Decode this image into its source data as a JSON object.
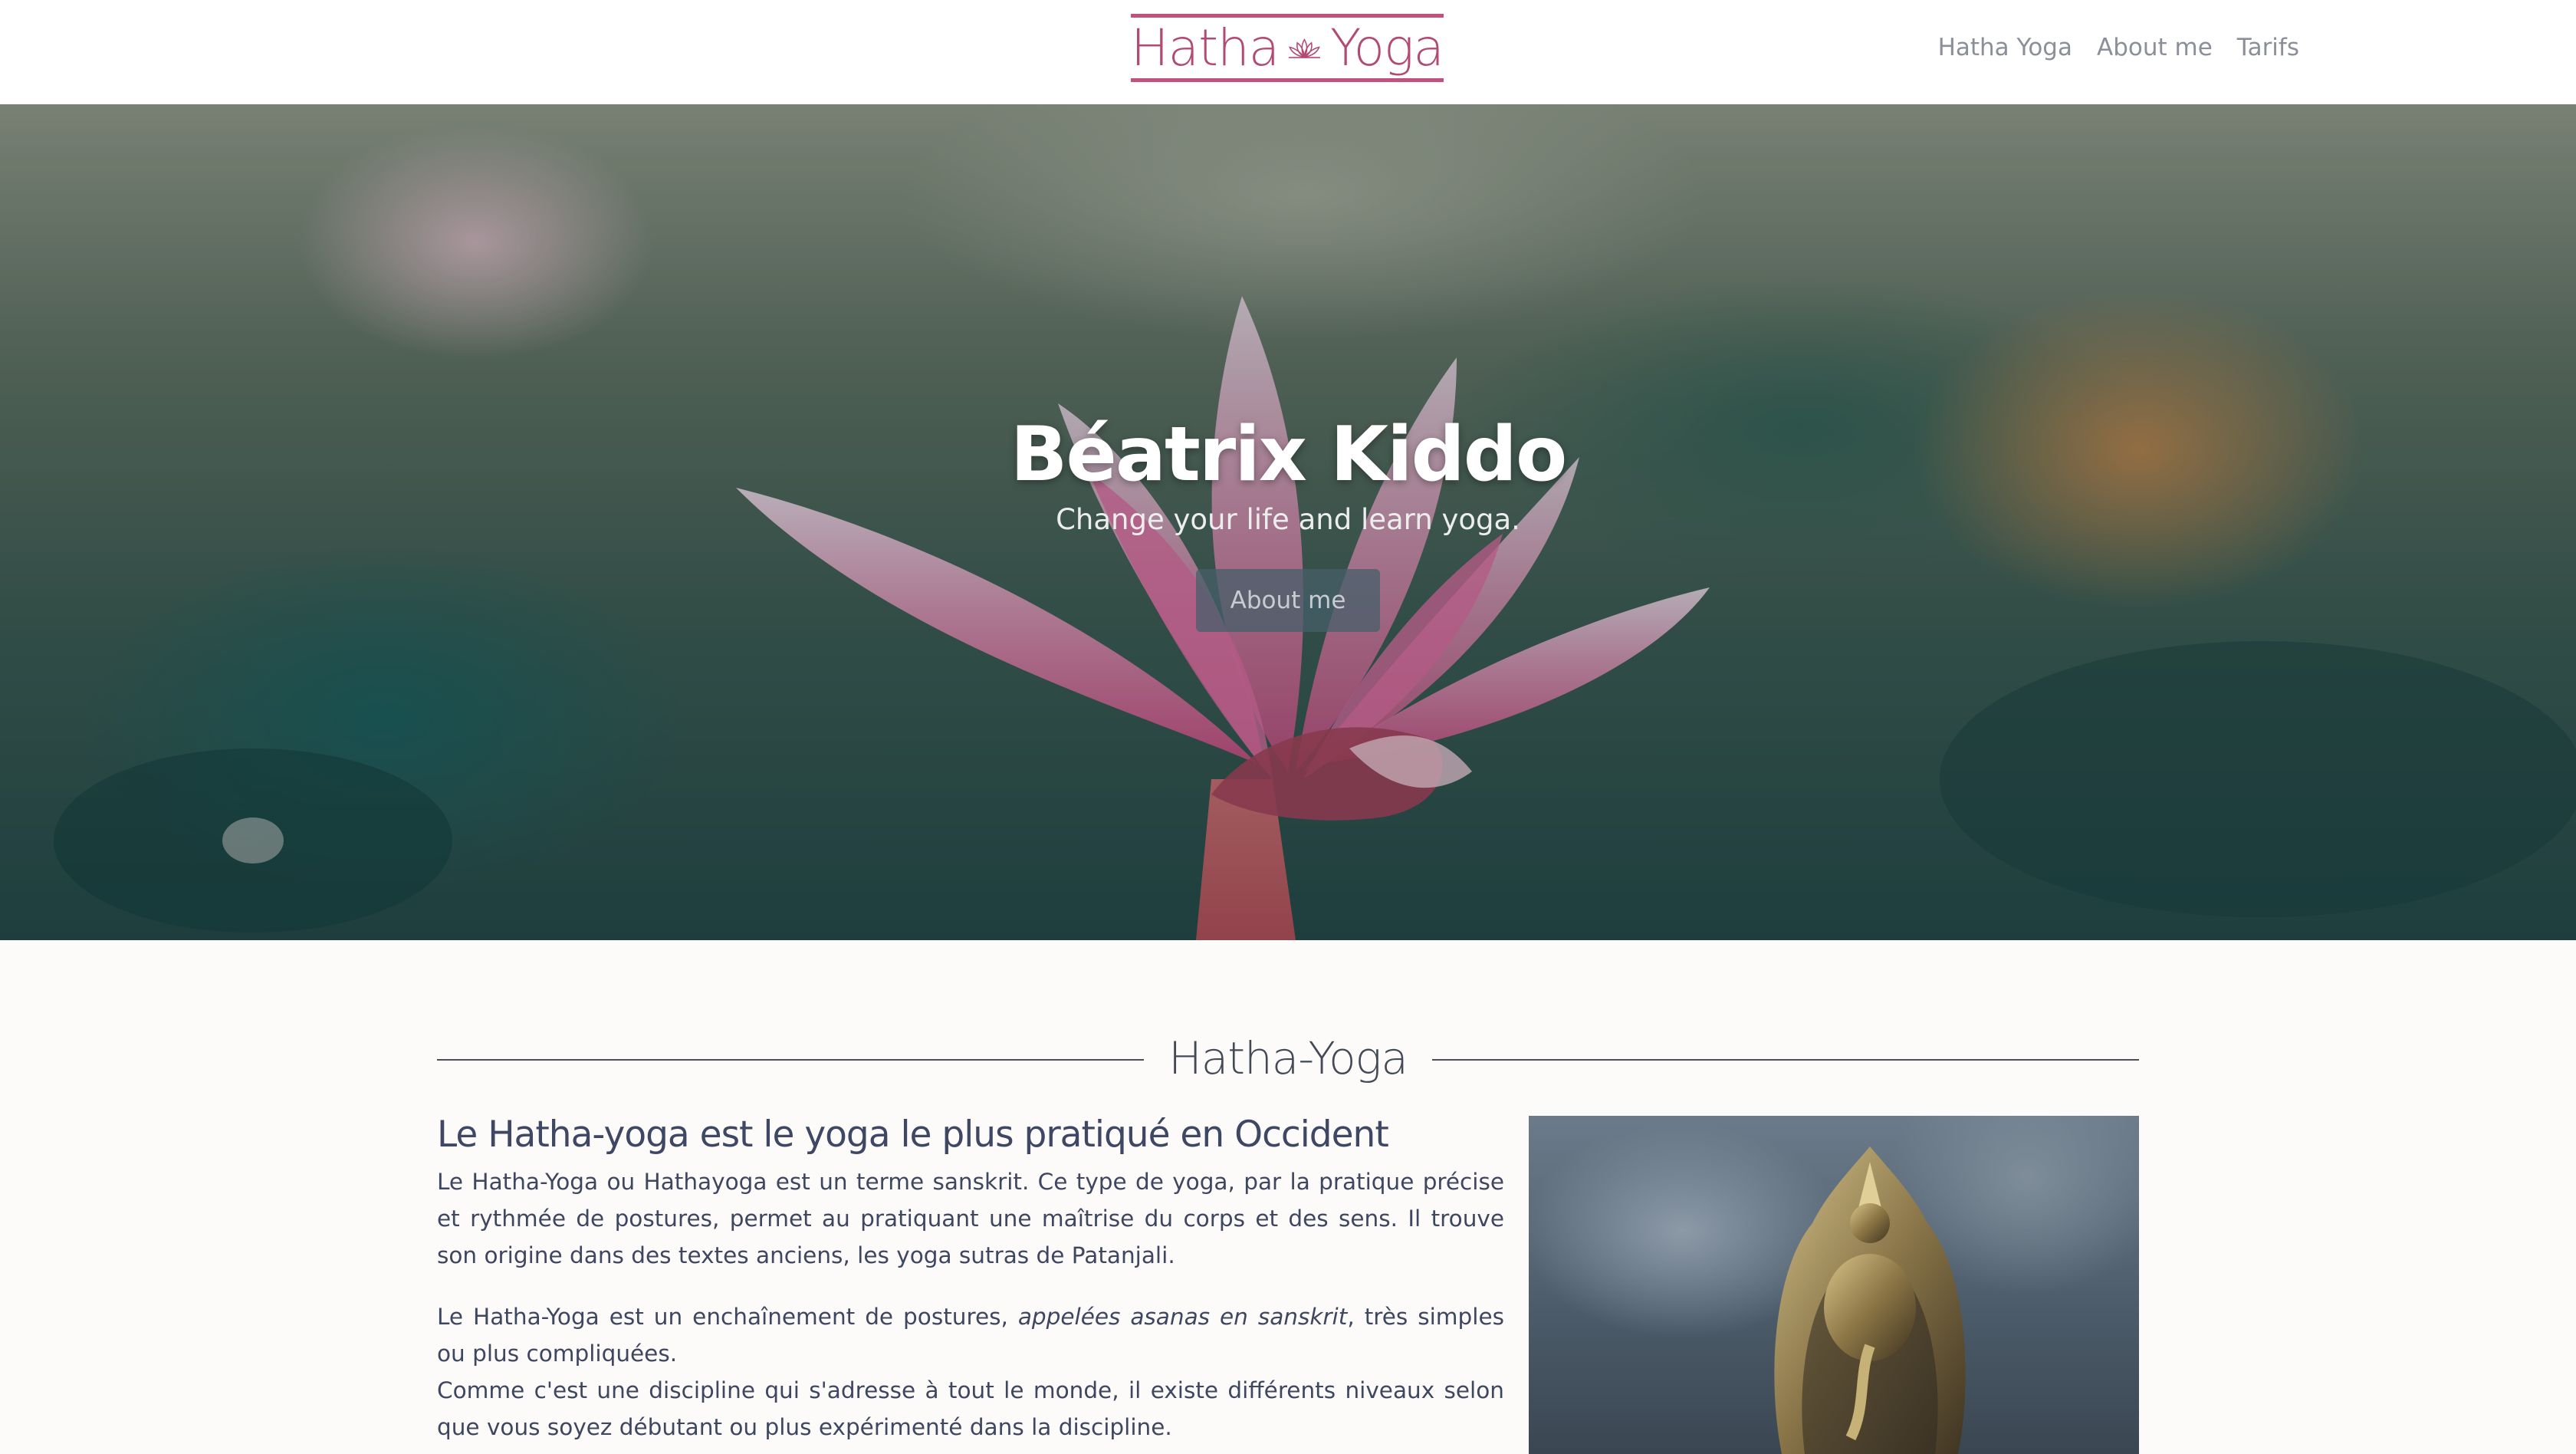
{
  "brand": {
    "word_left": "Hatha",
    "word_right": "Yoga",
    "icon": "lotus-icon",
    "accent_color": "#c0527e"
  },
  "nav": {
    "items": [
      {
        "label": "Hatha Yoga"
      },
      {
        "label": "About me"
      },
      {
        "label": "Tarifs"
      }
    ]
  },
  "hero": {
    "title": "Béatrix Kiddo",
    "subtitle": "Change your life and learn yoga.",
    "button_label": "About me"
  },
  "section": {
    "title": "Hatha-Yoga",
    "heading": "Le Hatha-yoga est le yoga le plus pratiqué en Occident",
    "p1": "Le Hatha-Yoga ou Hathayoga est un terme sanskrit. Ce type de yoga, par la pratique précise et rythmée de postures, permet au pratiquant une maîtrise du corps et des sens. Il trouve son origine dans des textes anciens, les yoga sutras de Patanjali.",
    "p2_before": "Le Hatha-Yoga est un enchaînement de postures, ",
    "p2_em": "appelées asanas en sanskrit",
    "p2_after": ", très simples ou plus compliquées.",
    "p3": "Comme c'est une discipline qui s'adresse à tout le monde, il existe différents niveaux selon que vous soyez débutant ou plus expérimenté dans la discipline."
  }
}
